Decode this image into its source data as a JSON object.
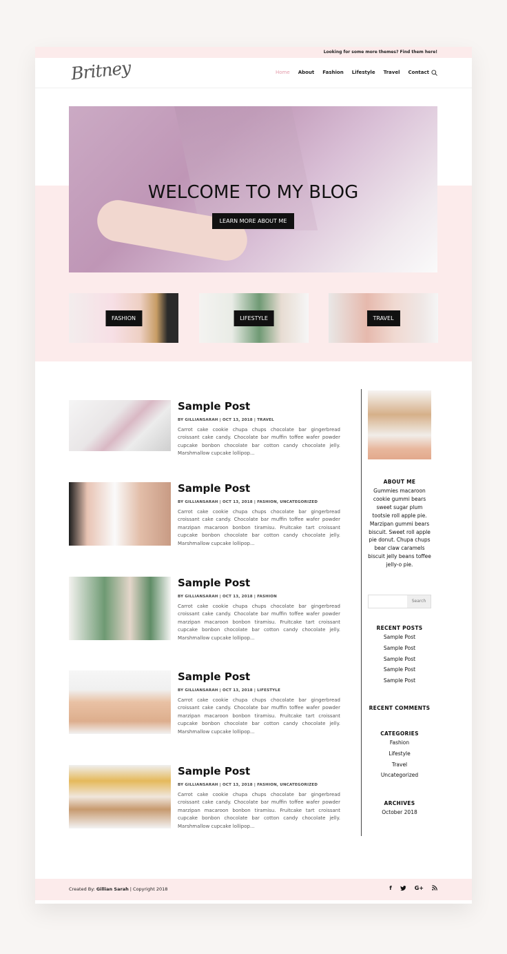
{
  "topbar": {
    "promo": "Looking for some more themes? Find them here!"
  },
  "header": {
    "logo": "Britney",
    "nav": [
      "Home",
      "About",
      "Fashion",
      "Lifestyle",
      "Travel",
      "Contact"
    ]
  },
  "hero": {
    "title": "WELCOME TO MY BLOG",
    "button": "LEARN MORE ABOUT ME"
  },
  "categories": [
    "FASHION",
    "LIFESTYLE",
    "TRAVEL"
  ],
  "posts": [
    {
      "title": "Sample Post",
      "meta": "BY GILLIANSARAH | OCT 13, 2018 | TRAVEL",
      "excerpt": "Carrot cake cookie chupa chups chocolate bar gingerbread croissant cake candy. Chocolate bar muffin toffee wafer powder cupcake bonbon chocolate bar cotton candy chocolate jelly. Marshmallow cupcake lollipop..."
    },
    {
      "title": "Sample Post",
      "meta": "BY GILLIANSARAH | OCT 13, 2018 | FASHION, UNCATEGORIZED",
      "excerpt": "Carrot cake cookie chupa chups chocolate bar gingerbread croissant cake candy. Chocolate bar muffin toffee wafer powder marzipan macaroon bonbon tiramisu. Fruitcake tart croissant cupcake bonbon chocolate bar cotton candy chocolate jelly. Marshmallow cupcake lollipop..."
    },
    {
      "title": "Sample Post",
      "meta": "BY GILLIANSARAH | OCT 13, 2018 | FASHION",
      "excerpt": "Carrot cake cookie chupa chups chocolate bar gingerbread croissant cake candy. Chocolate bar muffin toffee wafer powder marzipan macaroon bonbon tiramisu. Fruitcake tart croissant cupcake bonbon chocolate bar cotton candy chocolate jelly. Marshmallow cupcake lollipop..."
    },
    {
      "title": "Sample Post",
      "meta": "BY GILLIANSARAH | OCT 13, 2018 | LIFESTYLE",
      "excerpt": "Carrot cake cookie chupa chups chocolate bar gingerbread croissant cake candy. Chocolate bar muffin toffee wafer powder marzipan macaroon bonbon tiramisu. Fruitcake tart croissant cupcake bonbon chocolate bar cotton candy chocolate jelly. Marshmallow cupcake lollipop..."
    },
    {
      "title": "Sample Post",
      "meta": "BY GILLIANSARAH | OCT 13, 2018 | FASHION, UNCATEGORIZED",
      "excerpt": "Carrot cake cookie chupa chups chocolate bar gingerbread croissant cake candy. Chocolate bar muffin toffee wafer powder marzipan macaroon bonbon tiramisu. Fruitcake tart croissant cupcake bonbon chocolate bar cotton candy chocolate jelly. Marshmallow cupcake lollipop..."
    }
  ],
  "sidebar": {
    "about_title": "ABOUT ME",
    "about_text": "Gummies macaroon cookie gummi bears sweet sugar plum tootsie roll apple pie. Marzipan gummi bears biscuit. Sweet roll apple pie donut. Chupa chups bear claw caramels biscuit jelly beans toffee jelly-o pie.",
    "search_button": "Search",
    "recent_posts_title": "RECENT POSTS",
    "recent_posts": [
      "Sample Post",
      "Sample Post",
      "Sample Post",
      "Sample Post",
      "Sample Post"
    ],
    "recent_comments_title": "RECENT COMMENTS",
    "categories_title": "CATEGORIES",
    "categories": [
      "Fashion",
      "Lifestyle",
      "Travel",
      "Uncategorized"
    ],
    "archives_title": "ARCHIVES",
    "archives": [
      "October 2018"
    ]
  },
  "footer": {
    "credit_prefix": "Created By: ",
    "credit_name": "Gillian Sarah",
    "credit_suffix": " | Copyright 2018",
    "social": [
      "f",
      "t",
      "G+",
      "rss"
    ]
  },
  "colors": {
    "accent_pink": "#fcebeb",
    "nav_active": "#e39aa9",
    "dark": "#111111"
  }
}
